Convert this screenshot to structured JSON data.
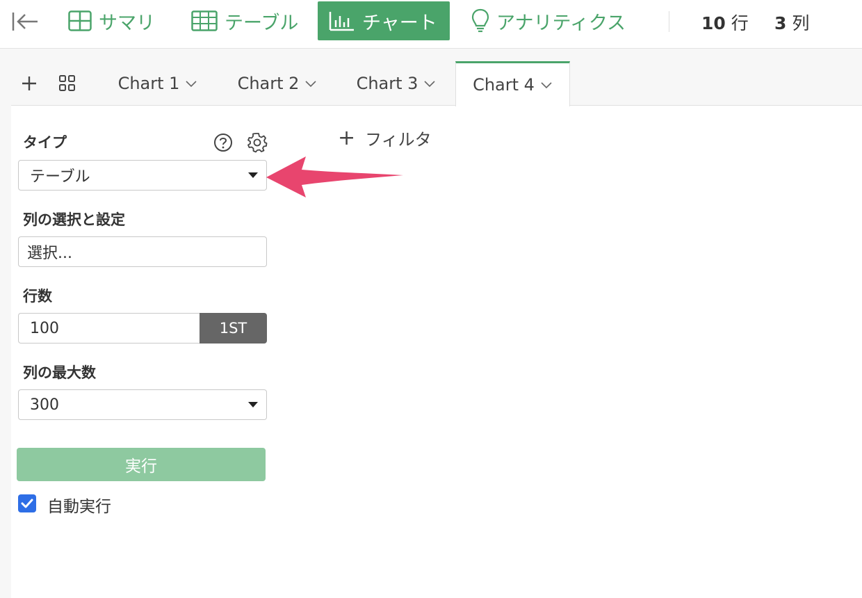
{
  "nav": {
    "summary": "サマリ",
    "table": "テーブル",
    "chart": "チャート",
    "analytics": "アナリティクス"
  },
  "counts": {
    "rows_value": "10",
    "rows_unit": "行",
    "cols_value": "3",
    "cols_unit": "列"
  },
  "tabs": [
    {
      "label": "Chart 1"
    },
    {
      "label": "Chart 2"
    },
    {
      "label": "Chart 3"
    },
    {
      "label": "Chart 4"
    }
  ],
  "panel": {
    "type_label": "タイプ",
    "type_value": "テーブル",
    "columns_label": "列の選択と設定",
    "columns_placeholder": "選択...",
    "rows_label": "行数",
    "rows_value": "100",
    "rows_button": "1ST",
    "max_cols_label": "列の最大数",
    "max_cols_value": "300",
    "run_button": "実行",
    "auto_run_label": "自動実行",
    "auto_run_checked": true
  },
  "filter": {
    "label": "フィルタ"
  },
  "colors": {
    "accent": "#4aa46a",
    "run_button": "#8ec9a0",
    "checkbox": "#2e6ee6",
    "annotation_arrow": "#e8456e"
  }
}
